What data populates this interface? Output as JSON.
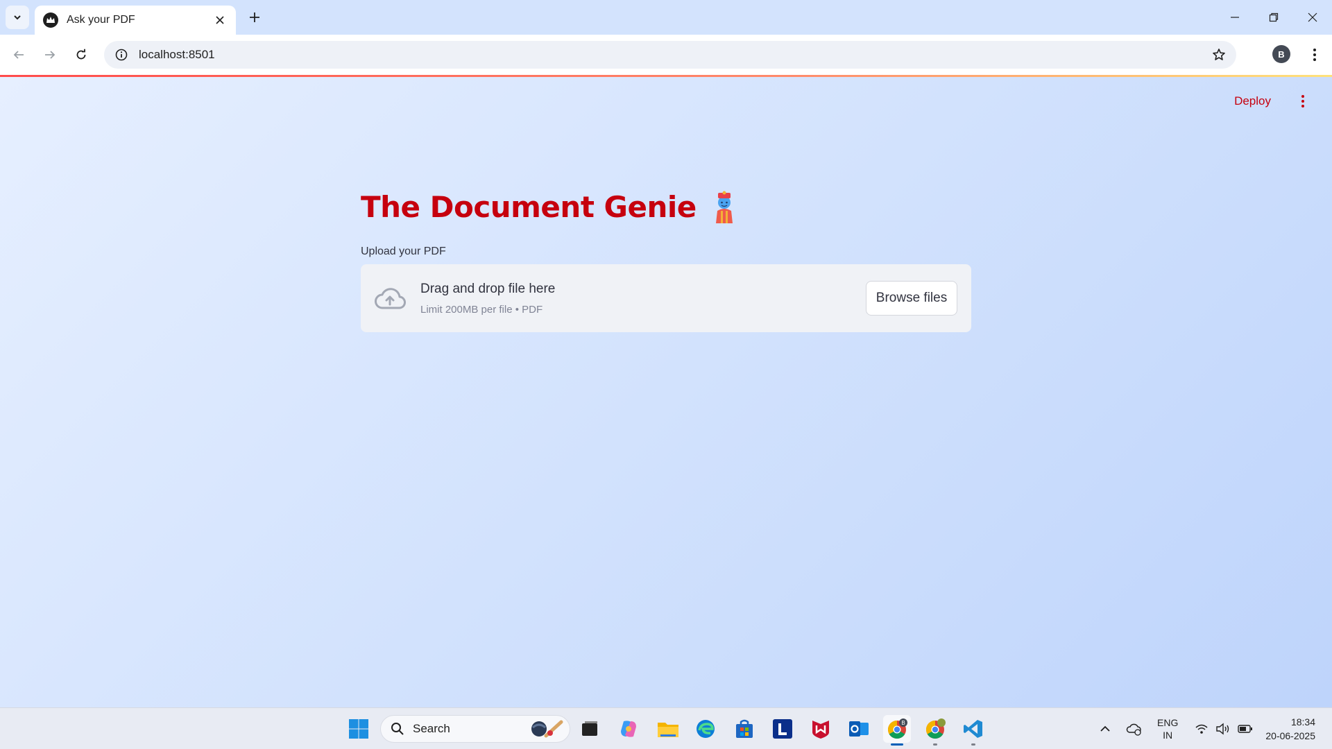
{
  "browser": {
    "tab_title": "Ask your PDF",
    "url": "localhost:8501",
    "profile_initial": "B"
  },
  "app": {
    "deploy_label": "Deploy",
    "title": "The Document Genie",
    "upload_label": "Upload your PDF",
    "dropzone_title": "Drag and drop file here",
    "dropzone_limit": "Limit 200MB per file • PDF",
    "browse_label": "Browse files",
    "accent_color": "#c6000e"
  },
  "taskbar": {
    "search_placeholder": "Search",
    "pinned": [
      "start-icon",
      "search-icon",
      "task-view-icon",
      "copilot-icon",
      "file-explorer-icon",
      "edge-icon",
      "microsoft-store-icon",
      "l-app-icon",
      "mcafee-icon",
      "outlook-icon",
      "chrome-profile-b-icon",
      "chrome-icon",
      "vscode-icon"
    ],
    "language_line1": "ENG",
    "language_line2": "IN",
    "time": "18:34",
    "date": "20-06-2025"
  }
}
